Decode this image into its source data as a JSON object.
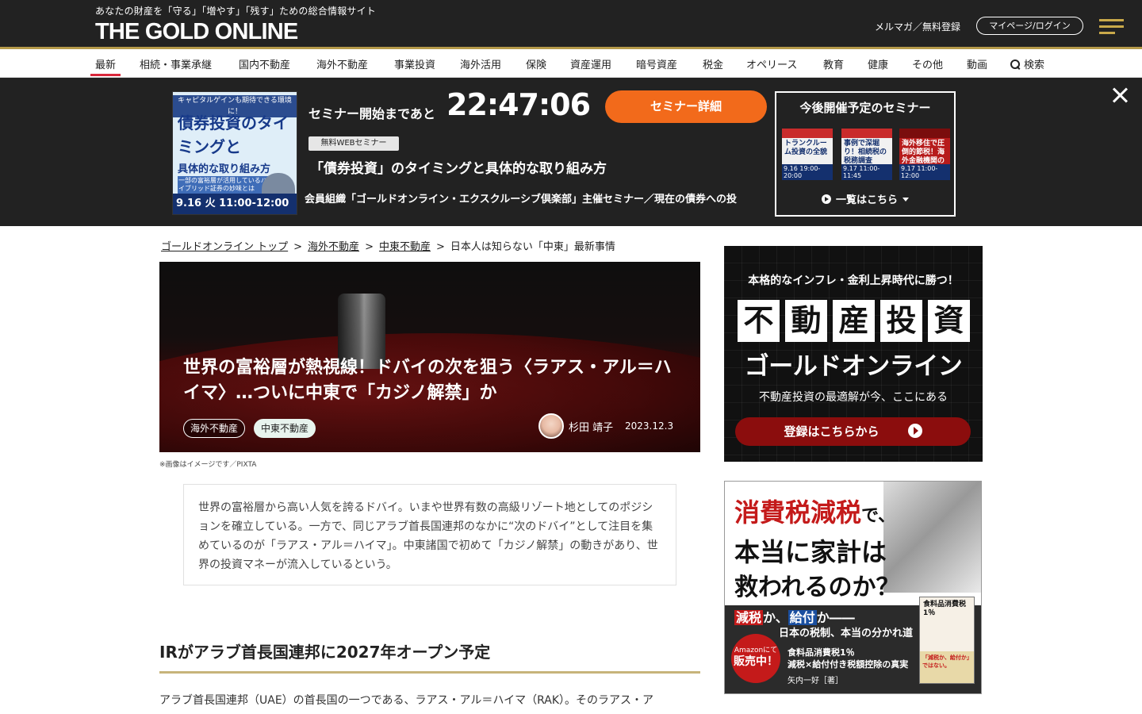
{
  "header": {
    "tagline": "あなたの財産を「守る」「増やす」「残す」ための総合情報サイト",
    "logo": "THE GOLD ONLINE",
    "newsletter_link": "メルマガ／無料登録",
    "mypage_button": "マイページ/ログイン"
  },
  "nav": {
    "items": [
      "最新",
      "相続・事業承継",
      "国内不動産",
      "海外不動産",
      "事業投資",
      "海外活用",
      "保険",
      "資産運用",
      "暗号資産",
      "税金",
      "オペリース",
      "教育",
      "健康",
      "その他",
      "動画"
    ],
    "search_label": "検索",
    "active_index": 0
  },
  "seminar": {
    "thumb": {
      "top": "キャピタルゲインも期待できる環境に！",
      "main": "債券投資のタイミングと",
      "sub": "具体的な取り組み方",
      "note": "一部の富裕層が活用しているハイブリッド証券の妙味とは",
      "date": "9.16 火 11:00-12:00"
    },
    "countdown_label": "セミナー開始まであと",
    "countdown": "22:47:06",
    "detail_button": "セミナー詳細",
    "free_tag": "無料WEBセミナー",
    "title": "「債券投資」のタイミングと具体的な取り組み方",
    "description": "会員組織「ゴールドオンライン・エクスクルーシブ倶楽部」主催セミナー／現在の債券への投",
    "upcoming_title": "今後開催予定のセミナー",
    "upcoming": [
      {
        "text": "トランクルーム投資の全貌",
        "date": "9.16 19:00-20:00"
      },
      {
        "text": "事例で深堀り！相続税の税務調査",
        "date": "9.17 11:00-11:45"
      },
      {
        "text": "海外移住で圧倒的節税！海外金融機関の活用法",
        "date": "9.17 11:00-12:00"
      }
    ],
    "list_link": "一覧はこちら"
  },
  "breadcrumb": {
    "items": [
      "ゴールドオンライン トップ",
      "海外不動産",
      "中東不動産"
    ],
    "current": "日本人は知らない「中東」最新事情",
    "separator": ">"
  },
  "article": {
    "title": "世界の富裕層が熱視線！ドバイの次を狙う〈ラアス・アル＝ハイマ〉…ついに中東で「カジノ解禁」か",
    "tags": [
      "海外不動産",
      "中東不動産"
    ],
    "author": "杉田 靖子",
    "date": "2023.12.3",
    "caption": "※画像はイメージです／PIXTA",
    "lead": "世界の富裕層から高い人気を誇るドバイ。いまや世界有数の高級リゾート地としてのポジションを確立している。一方で、同じアラブ首長国連邦のなかに“次のドバイ”として注目を集めているのが「ラアス・アル＝ハイマ」。中東諸国で初めて「カジノ解禁」の動きがあり、世界の投資マネーが流入しているという。",
    "section_heading": "IRがアラブ首長国連邦に2027年オープン予定",
    "body_start": "アラブ首長国連邦（UAE）の首長国の一つである、ラアス・アル＝ハイマ（RAK）。そのラアス・ア"
  },
  "ad1": {
    "top": "本格的なインフレ・金利上昇時代に勝つ！",
    "kanji": [
      "不",
      "動",
      "産",
      "投",
      "資"
    ],
    "brand": "ゴールドオンライン",
    "sub": "不動産投資の最適解が今、ここにある",
    "button": "登録はこちらから"
  },
  "ad2": {
    "line1_red": "消費税減税",
    "line1_rest": "で、",
    "line2": "本当に家計は",
    "line3": "救われるのか？",
    "line4_a": "減税",
    "line4_b": "か、",
    "line4_c": "給付",
    "line4_d": "か――",
    "line5": "日本の税制、本当の分かれ道",
    "amazon_top": "Amazonにて",
    "amazon_main": "販売中！",
    "book_line1": "食料品消費税1％",
    "book_line2": "減税×給付付き税額控除の真実",
    "author": "矢内一好［著］",
    "cover_title": "食料品消費税1％",
    "cover_band": "「減税か、給付か」ではない。"
  }
}
